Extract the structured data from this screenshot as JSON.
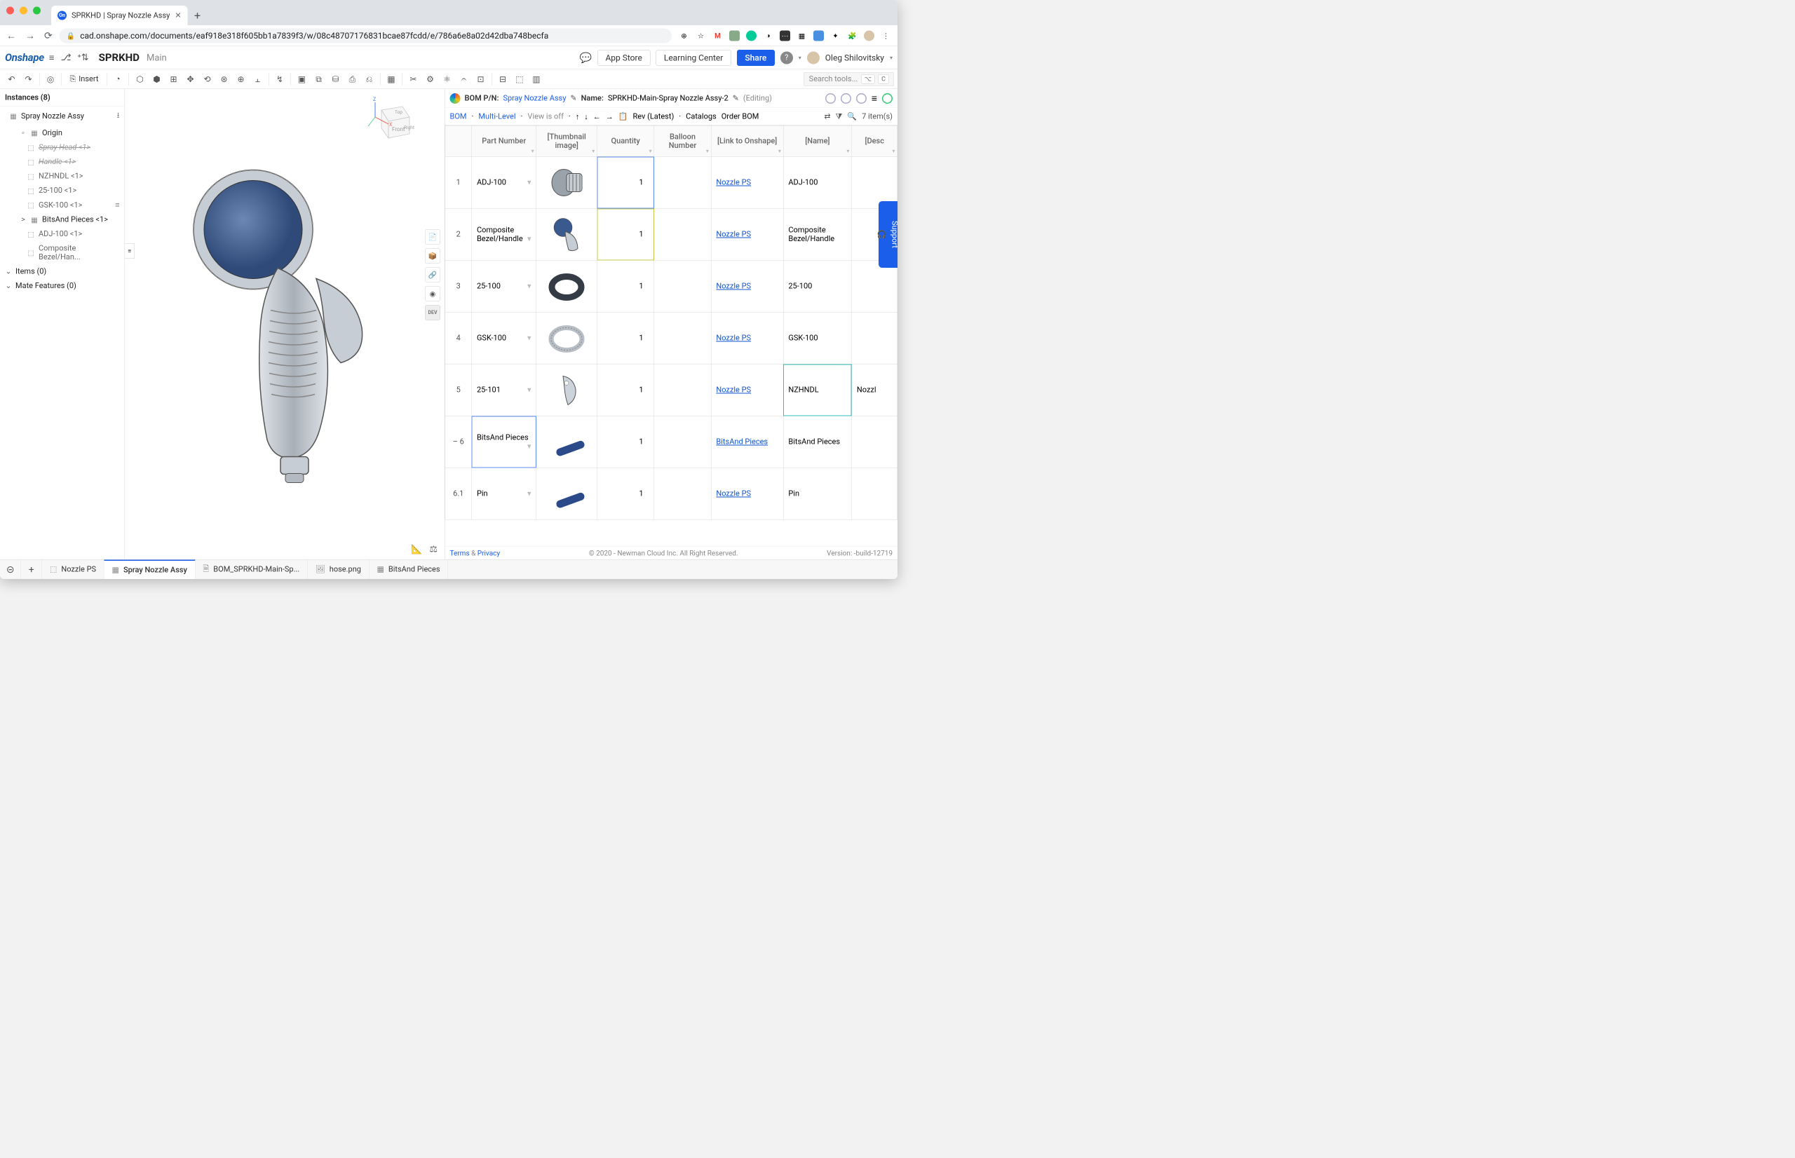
{
  "browser": {
    "tab_title": "SPRKHD | Spray Nozzle Assy",
    "url": "cad.onshape.com/documents/eaf918e318f605bb1a7839f3/w/08c48707176831bcae87fcdd/e/786a6e8a02d42dba748becfa"
  },
  "header": {
    "logo": "Onshape",
    "doc_title": "SPRKHD",
    "doc_sub": "Main",
    "app_store": "App Store",
    "learning_center": "Learning Center",
    "share": "Share",
    "username": "Oleg Shilovitsky"
  },
  "toolbar": {
    "insert": "Insert",
    "search_placeholder": "Search tools..."
  },
  "instances": {
    "heading": "Instances (8)",
    "root": "Spray Nozzle Assy",
    "items": [
      {
        "label": "Origin",
        "indent": "child",
        "strike": false
      },
      {
        "label": "Spray Head <1>",
        "indent": "gchild",
        "strike": true
      },
      {
        "label": "Handle <1>",
        "indent": "gchild",
        "strike": true
      },
      {
        "label": "NZHNDL <1>",
        "indent": "gchild",
        "strike": false
      },
      {
        "label": "25-100 <1>",
        "indent": "gchild",
        "strike": false
      },
      {
        "label": "GSK-100 <1>",
        "indent": "gchild",
        "strike": false,
        "tail": "≡"
      },
      {
        "label": "BitsAnd Pieces <1>",
        "indent": "child",
        "strike": false,
        "expander": ">"
      },
      {
        "label": "ADJ-100 <1>",
        "indent": "gchild",
        "strike": false
      },
      {
        "label": "Composite Bezel/Han...",
        "indent": "gchild",
        "strike": false
      }
    ],
    "section_items": "Items (0)",
    "section_mates": "Mate Features (0)"
  },
  "bom_header": {
    "pn_label": "BOM P/N:",
    "pn_value": "Spray Nozzle Assy",
    "name_label": "Name:",
    "name_value": "SPRKHD-Main-Spray Nozzle Assy-2",
    "editing": "(Editing)"
  },
  "bom_sub": {
    "bom": "BOM",
    "multi": "Multi-Level",
    "view": "View is off",
    "rev": "Rev (Latest)",
    "catalogs": "Catalogs",
    "order": "Order BOM",
    "items": "7 item(s)"
  },
  "bom_columns": [
    "",
    "Part Number",
    "[Thumbnail image]",
    "Quantity",
    "Balloon Number",
    "[Link to Onshape]",
    "[Name]",
    "[Desc"
  ],
  "bom_rows": [
    {
      "n": "1",
      "pn": "ADJ-100",
      "qty": "1",
      "bn": "",
      "link": "Nozzle PS",
      "name": "ADJ-100",
      "thumb": "adj",
      "hl": ""
    },
    {
      "n": "2",
      "pn": "Composite Bezel/Handle",
      "qty": "1",
      "bn": "",
      "link": "Nozzle PS",
      "name": "Composite Bezel/Handle",
      "thumb": "bezel",
      "hl": "yellow"
    },
    {
      "n": "3",
      "pn": "25-100",
      "qty": "1",
      "bn": "",
      "link": "Nozzle PS",
      "name": "25-100",
      "thumb": "oring",
      "hl": ""
    },
    {
      "n": "4",
      "pn": "GSK-100",
      "qty": "1",
      "bn": "",
      "link": "Nozzle PS",
      "name": "GSK-100",
      "thumb": "gasket",
      "hl": ""
    },
    {
      "n": "5",
      "pn": "25-101",
      "qty": "1",
      "bn": "",
      "link": "Nozzle PS",
      "name": "NZHNDL",
      "thumb": "lever",
      "hl": "",
      "name_hl": "teal"
    },
    {
      "n": "6",
      "pn": "BitsAnd Pieces",
      "qty": "1",
      "bn": "",
      "link": "BitsAnd Pieces",
      "name": "BitsAnd Pieces",
      "thumb": "pin",
      "hl": "blue",
      "prefix": "–"
    },
    {
      "n": "6.1",
      "pn": "Pin",
      "qty": "1",
      "bn": "",
      "link": "Nozzle PS",
      "name": "Pin",
      "thumb": "pin",
      "hl": ""
    }
  ],
  "bom_footer": {
    "terms": "Terms",
    "amp": "&",
    "privacy": "Privacy",
    "copyright": "© 2020 - Newman Cloud Inc. All Right Reserved.",
    "version": "Version: -build-12719"
  },
  "support": "Support",
  "bottom_tabs": [
    {
      "label": "Nozzle PS",
      "icon": "⬚",
      "active": false
    },
    {
      "label": "Spray Nozzle Assy",
      "icon": "▦",
      "active": true
    },
    {
      "label": "BOM_SPRKHD-Main-Sp...",
      "icon": "🗎",
      "active": false
    },
    {
      "label": "hose.png",
      "icon": "🖼",
      "active": false
    },
    {
      "label": "BitsAnd Pieces",
      "icon": "▦",
      "active": false
    }
  ]
}
